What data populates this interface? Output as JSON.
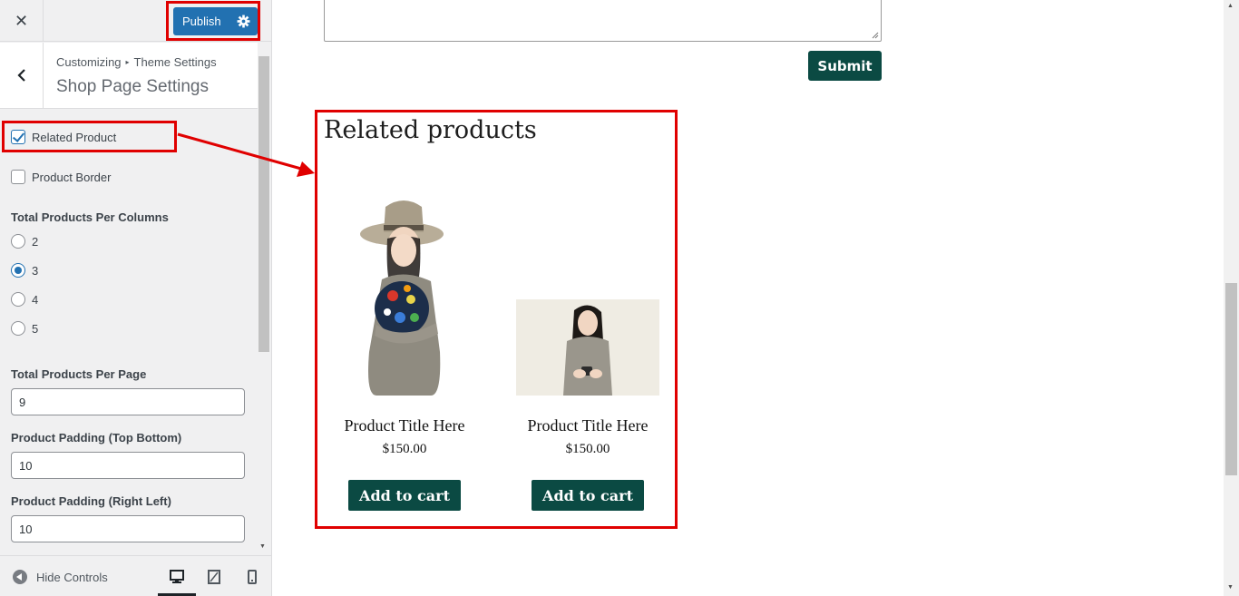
{
  "header": {
    "close_glyph": "✕",
    "publish_label": "Publish"
  },
  "section": {
    "breadcrumb_root": "Customizing",
    "breadcrumb_sep": "▸",
    "breadcrumb_parent": "Theme Settings",
    "title": "Shop Page Settings"
  },
  "controls": {
    "related_product": {
      "label": "Related Product",
      "checked": true
    },
    "product_border": {
      "label": "Product Border",
      "checked": false
    },
    "columns": {
      "title": "Total Products Per Columns",
      "options": [
        "2",
        "3",
        "4",
        "5"
      ],
      "selected": "3"
    },
    "per_page": {
      "title": "Total Products Per Page",
      "value": "9"
    },
    "padding_tb": {
      "title": "Product Padding (Top Bottom)",
      "value": "10"
    },
    "padding_rl": {
      "title": "Product Padding (Right Left)",
      "value": "10"
    }
  },
  "footer": {
    "hide_controls_label": "Hide Controls",
    "devices": [
      "desktop",
      "tablet",
      "mobile"
    ],
    "active_device": "desktop"
  },
  "preview": {
    "submit_label": "Submit",
    "related_title": "Related products",
    "products": [
      {
        "title": "Product Title Here",
        "price": "$150.00",
        "cart_label": "Add to cart"
      },
      {
        "title": "Product Title Here",
        "price": "$150.00",
        "cart_label": "Add to cart"
      }
    ]
  },
  "colors": {
    "publish_blue": "#2271b1",
    "button_green": "#0b4a43",
    "annotation_red": "#e00000"
  }
}
